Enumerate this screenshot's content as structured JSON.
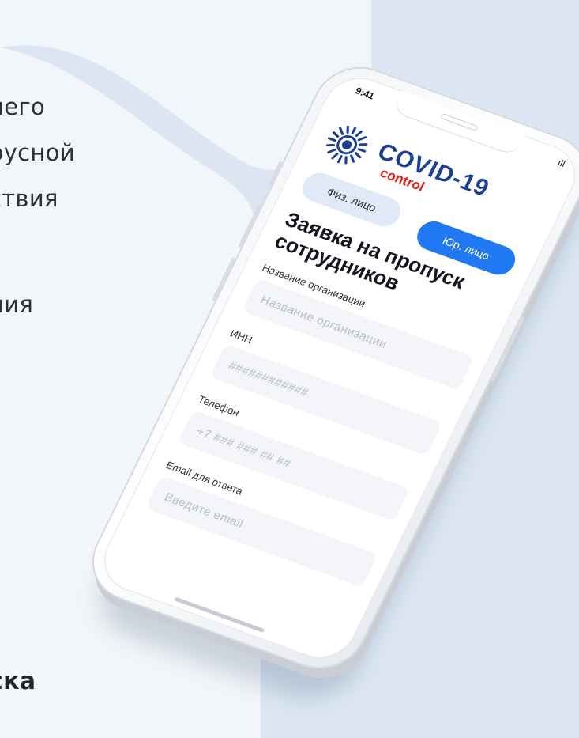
{
  "left_text": {
    "lines": [
      "него",
      "русной",
      "ствия",
      "ния",
      "ска"
    ]
  },
  "phone": {
    "status": {
      "time": "9:41",
      "signal": "ıll"
    },
    "logo": {
      "title": "COVID-19",
      "subtitle": "control",
      "title_color": "#1c3f94",
      "subtitle_color": "#e2231a",
      "icon": "virus-sun-icon"
    },
    "tabs": [
      {
        "label": "Физ. лицо",
        "active": false
      },
      {
        "label": "Юр. лицо",
        "active": true
      }
    ],
    "form": {
      "title": "Заявка на пропуск сотрудников",
      "fields": [
        {
          "label": "Название организации",
          "placeholder": "Название организации"
        },
        {
          "label": "ИНН",
          "placeholder": "############"
        },
        {
          "label": "Телефон",
          "placeholder": "+7 ### ### ## ##"
        },
        {
          "label": "Email для ответа",
          "placeholder": "Введите email"
        }
      ]
    },
    "accent_color": "#2079f2"
  }
}
